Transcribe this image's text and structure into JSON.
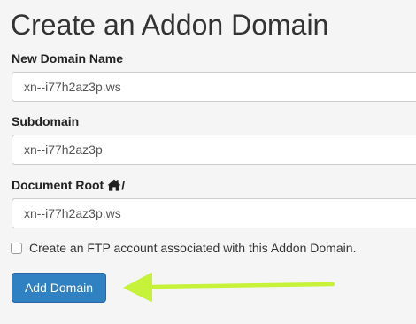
{
  "page": {
    "title": "Create an Addon Domain"
  },
  "form": {
    "new_domain": {
      "label": "New Domain Name",
      "value": "xn--i77h2az3p.ws"
    },
    "subdomain": {
      "label": "Subdomain",
      "value": "xn--i77h2az3p"
    },
    "document_root": {
      "label": "Document Root",
      "suffix": "/",
      "icon": "home-icon",
      "value": "xn--i77h2az3p.ws"
    },
    "ftp": {
      "label": "Create an FTP account associated with this Addon Domain.",
      "checked": false
    },
    "submit_label": "Add Domain"
  },
  "annotation": {
    "type": "arrow-pointing-left",
    "color": "#c6f23a"
  },
  "colors": {
    "button": "#2f81c1",
    "background": "#f5f5f5"
  }
}
